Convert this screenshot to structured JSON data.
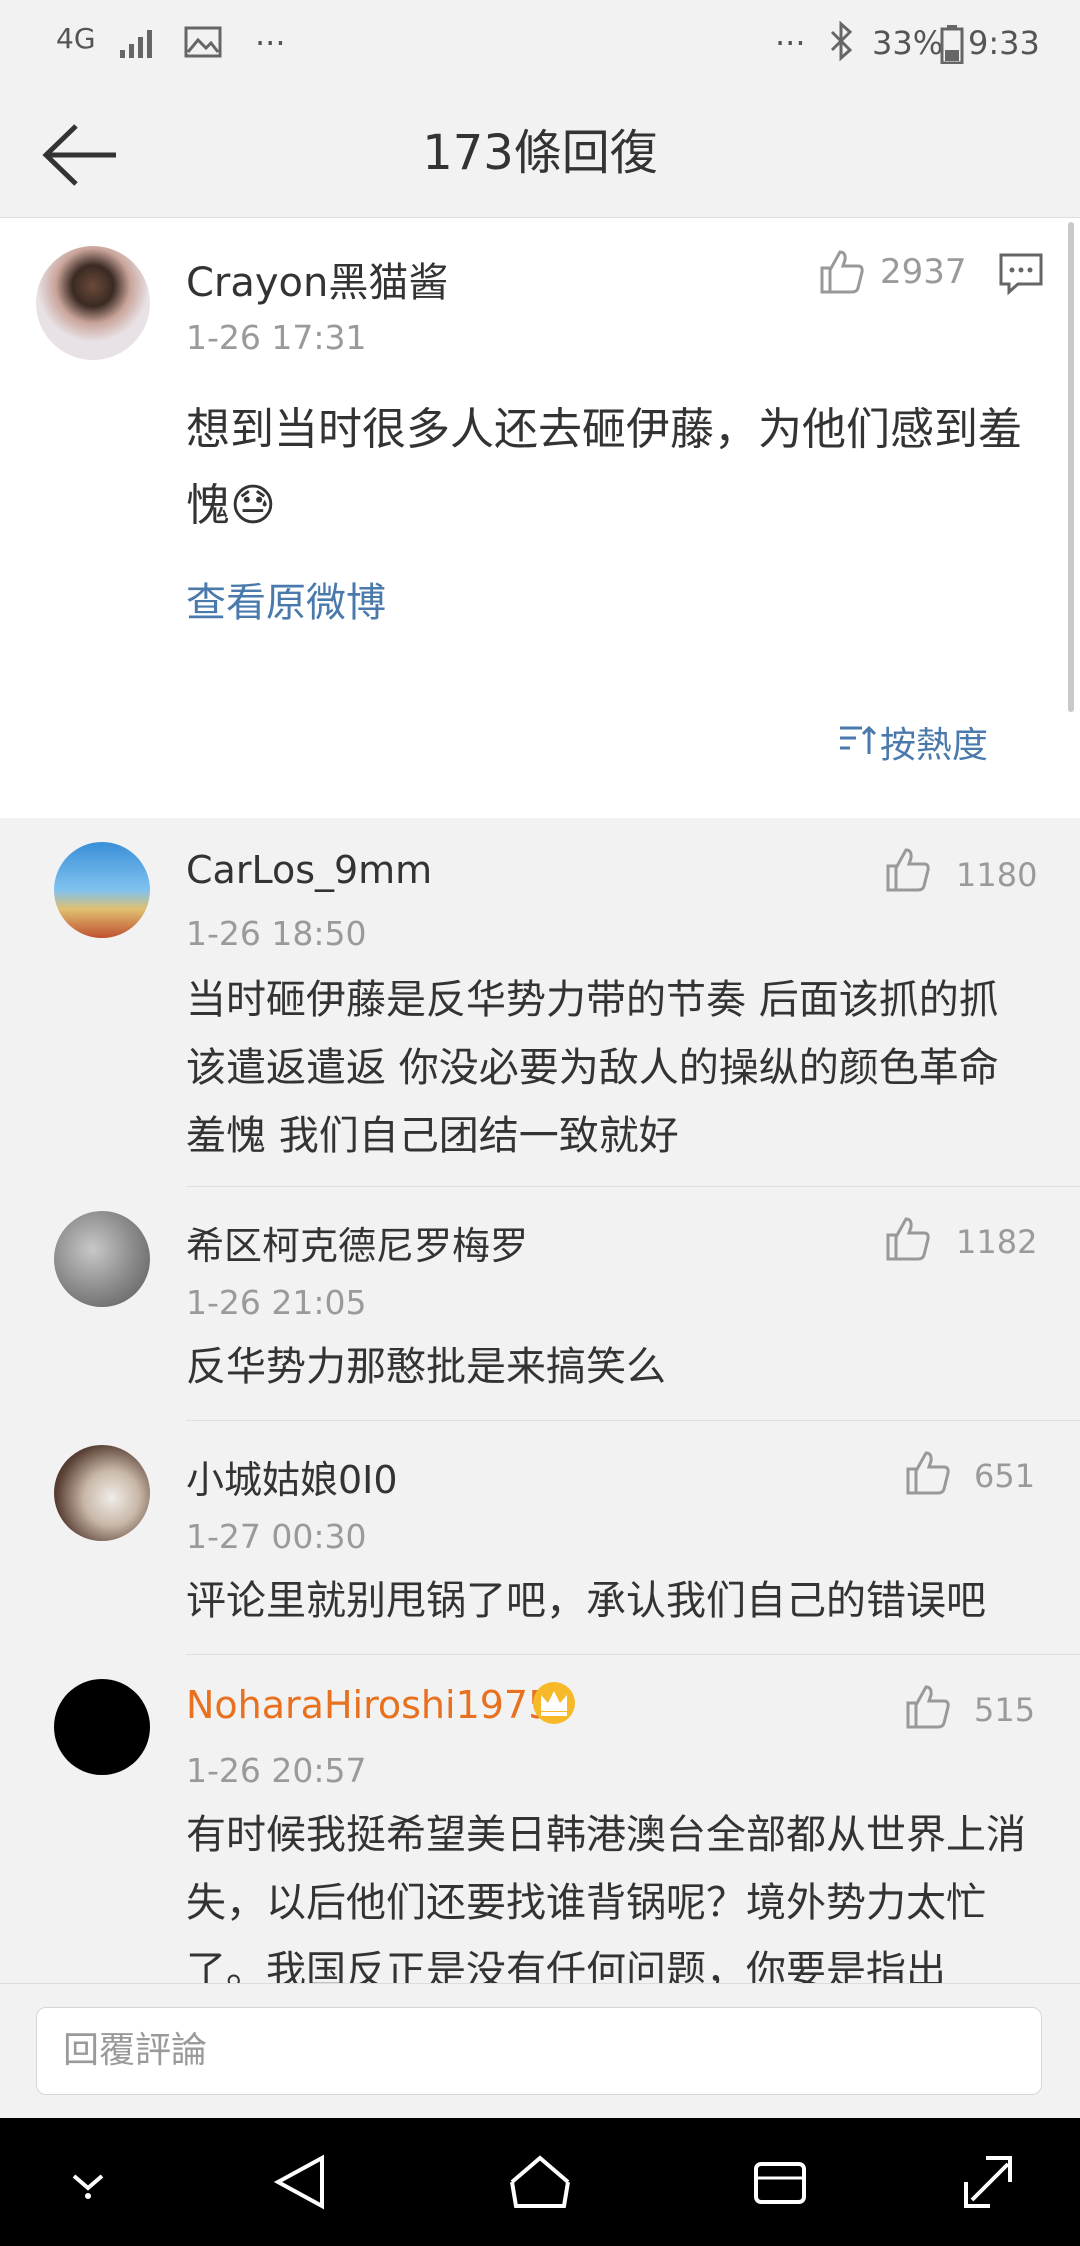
{
  "status_bar": {
    "network": "4G",
    "more_left": "···",
    "more_right": "···",
    "battery": "33%",
    "time": "9:33"
  },
  "header": {
    "title": "173條回復"
  },
  "post": {
    "author": "Crayon黑猫酱",
    "time": "1-26 17:31",
    "likes": "2937",
    "content": "想到当时很多人还去砸伊藤，为他们感到羞愧😓",
    "view_original": "查看原微博",
    "sort_label": "按熱度"
  },
  "comments": [
    {
      "author": "CarLos_9mm",
      "time": "1-26 18:50",
      "likes": "1180",
      "content": "当时砸伊藤是反华势力带的节奏 后面该抓的抓 该遣返遣返 你没必要为敌人的操纵的颜色革命羞愧 我们自己团结一致就好"
    },
    {
      "author": "希区柯克德尼罗梅罗",
      "time": "1-26 21:05",
      "likes": "1182",
      "content": "反华势力那憨批是来搞笑么"
    },
    {
      "author": "小城姑娘0I0",
      "time": "1-27 00:30",
      "likes": "651",
      "content": "评论里就别甩锅了吧，承认我们自己的错误吧"
    },
    {
      "author": "NoharaHiroshi1975",
      "time": "1-26 20:57",
      "likes": "515",
      "content": "有时候我挺希望美日韩港澳台全部都从世界上消失，以后他们还要找谁背锅呢？境外势力太忙了。我国反正是没有任何问题，你要是指出"
    }
  ],
  "reply": {
    "placeholder": "回覆評論"
  },
  "colors": {
    "link": "#4a79ab",
    "vip_name": "#e8711f",
    "background": "#f2f2f2"
  }
}
